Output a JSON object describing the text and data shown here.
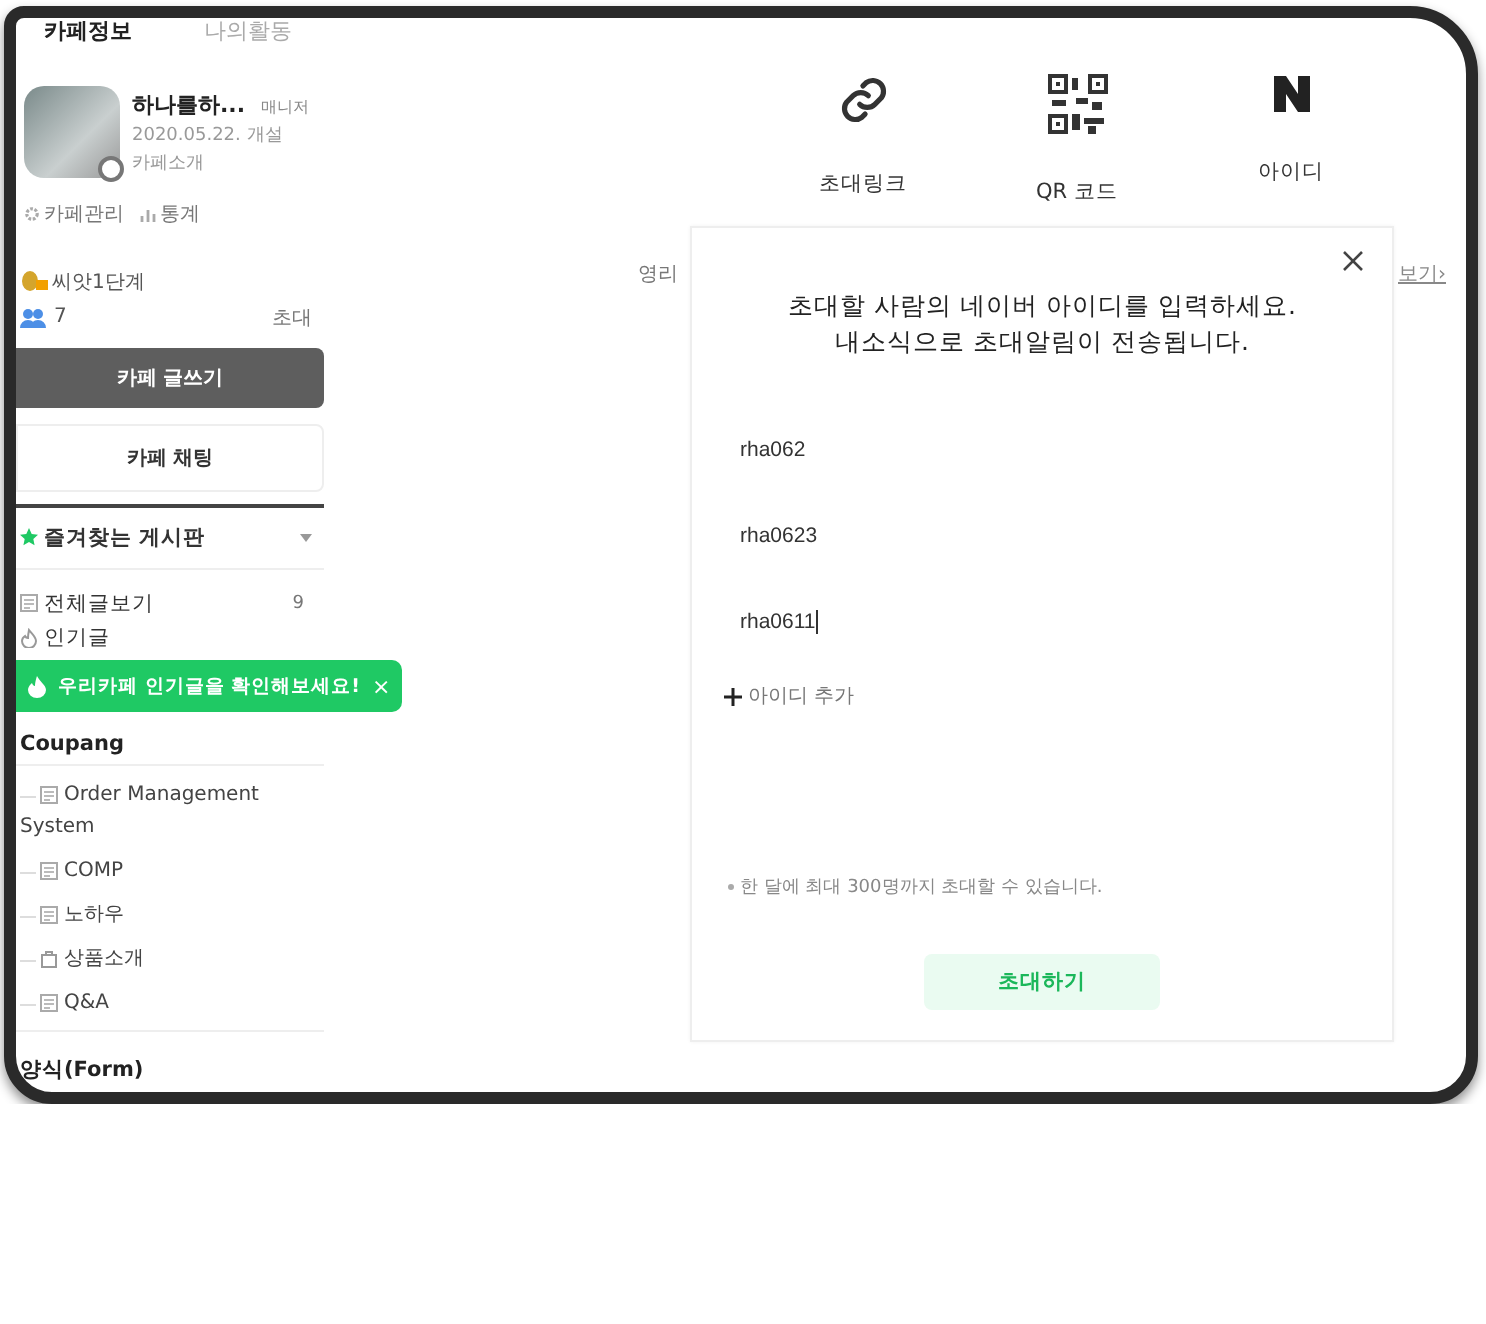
{
  "sidebar": {
    "tabs": [
      {
        "label": "카페정보",
        "selected": true
      },
      {
        "label": "나의활동",
        "selected": false
      }
    ],
    "cafe": {
      "name": "하나를하...",
      "role": "매니저",
      "opened": "2020.05.22. 개설",
      "intro": "카페소개"
    },
    "admin_links": [
      {
        "kind": "settings",
        "label": "카페관리"
      },
      {
        "kind": "stats",
        "label": "통계"
      }
    ],
    "level": "씨앗1단계",
    "members": "7",
    "invite": "초대",
    "buttons": [
      {
        "label": "카페 글쓰기",
        "kind": "primary"
      },
      {
        "label": "카페 채팅",
        "kind": "secondary"
      }
    ],
    "favorites": {
      "label": "즐겨찾는 게시판",
      "expanded": false
    },
    "boards": [
      {
        "kind": "all",
        "label": "전체글보기",
        "count": "9"
      },
      {
        "kind": "popular",
        "label": "인기글"
      }
    ],
    "tooltip": {
      "text": "우리카페 인기글을 확인해보세요!",
      "close": "×"
    },
    "groups": [
      {
        "title": "Coupang",
        "children": [
          {
            "kind": "board",
            "label": "Order Management System"
          },
          {
            "kind": "board",
            "label": "COMP"
          },
          {
            "kind": "board",
            "label": "노하우"
          },
          {
            "kind": "shop",
            "label": "상품소개"
          },
          {
            "kind": "board",
            "label": "Q&A"
          }
        ]
      },
      {
        "title": "양식(Form)"
      }
    ]
  },
  "invite_options": [
    {
      "kind": "link",
      "label": "초대링크"
    },
    {
      "kind": "qr",
      "label": "QR 코드"
    },
    {
      "kind": "naver",
      "label": "아이디"
    }
  ],
  "background": {
    "left_text": "영리",
    "right_link": "보기›"
  },
  "modal": {
    "title_lines": [
      "초대할 사람의 네이버 아이디를 입력하세요.",
      "내소식으로 초대알림이 전송됩니다."
    ],
    "ids": [
      {
        "value": "rha062",
        "focused": false
      },
      {
        "value": "rha0623",
        "focused": false
      },
      {
        "value": "rha0611",
        "focused": true
      }
    ],
    "add_label": "아이디 추가",
    "note": "한 달에 최대 300명까지 초대할 수 있습니다.",
    "submit": "초대하기"
  }
}
